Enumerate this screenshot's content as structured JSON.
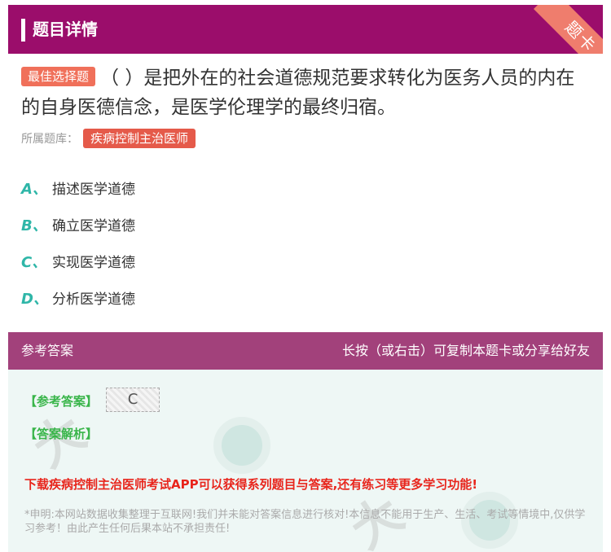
{
  "header": {
    "title": "题目详情",
    "ribbon_text": "题卡"
  },
  "question": {
    "type_tag": "最佳选择题",
    "text": "（ ）是把外在的社会道德规范要求转化为医务人员的内在的自身医德信念，是医学伦理学的最终归宿。"
  },
  "source": {
    "label": "所属题库：",
    "bank": "疾病控制主治医师"
  },
  "options": [
    {
      "letter": "A、",
      "text": "描述医学道德"
    },
    {
      "letter": "B、",
      "text": "确立医学道德"
    },
    {
      "letter": "C、",
      "text": "实现医学道德"
    },
    {
      "letter": "D、",
      "text": "分析医学道德"
    }
  ],
  "answer_panel": {
    "title": "参考答案",
    "hint": "长按（或右击）可复制本题卡或分享给好友",
    "ref_label": "【参考答案】",
    "answer": "C",
    "analysis_label": "【答案解析】",
    "promo": "下载疾病控制主治医师考试APP可以获得系列题目与答案,还有练习等更多学习功能!",
    "disclaimer": "*申明:本网站数据收集整理于互联网!我们并未能对答案信息进行核对!本信息不能用于生产、生活、考试等情境中,仅供学习参考！由此产生任何后果本站不承担责任!"
  },
  "colors": {
    "header": "#9b0d6b",
    "answer_header": "#a2417b",
    "option_letter": "#2fb6a8",
    "promo": "#e8251c",
    "tag": "#f0705a"
  }
}
